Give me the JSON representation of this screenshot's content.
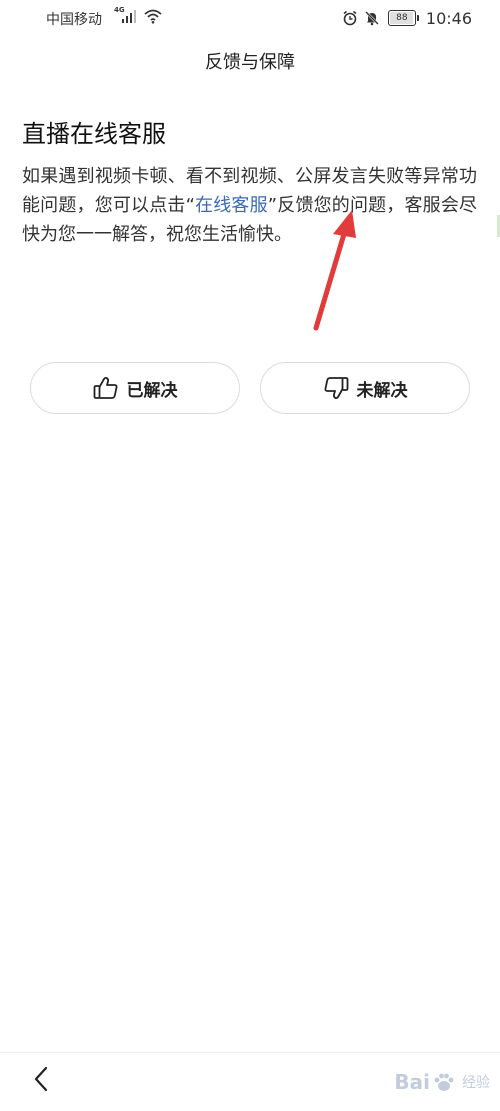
{
  "status_bar": {
    "carrier": "中国移动",
    "network": "4G",
    "battery": "88",
    "battery_level": 0.88,
    "time": "10:46"
  },
  "header": {
    "title": "反馈与保障"
  },
  "article": {
    "title": "直播在线客服",
    "body_before_link": "如果遇到视频卡顿、看不到视频、公屏发言失败等异常功能问题，您可以点击“",
    "link_text": "在线客服",
    "body_after_link": "”反馈您的问题，客服会尽快为您一一解答，祝您生活愉快。"
  },
  "feedback": {
    "resolved_label": "已解决",
    "unresolved_label": "未解决"
  },
  "watermark": {
    "brand": "Bai",
    "brand_tail": "经验"
  },
  "colors": {
    "link": "#3a6bb0",
    "arrow": "#e23b3b",
    "button_border": "#dcdcdc"
  },
  "icons": {
    "back": "chevron-left-icon",
    "resolved": "thumbs-up-icon",
    "unresolved": "thumbs-down-icon"
  }
}
